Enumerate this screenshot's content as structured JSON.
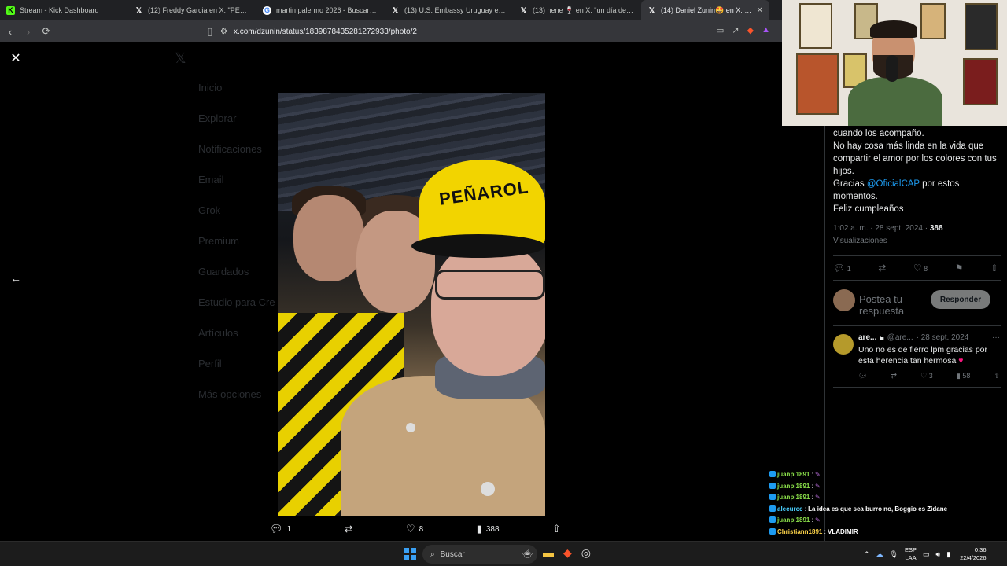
{
  "tabs": [
    {
      "title": "Stream - Kick Dashboard",
      "icon": "kick-icon"
    },
    {
      "title": "(12) Freddy Garcia en X: \"PEÑAROL I",
      "icon": "x-icon"
    },
    {
      "title": "martin palermo 2026 - Buscar con G",
      "icon": "google-icon"
    },
    {
      "title": "(13) U.S. Embassy Uruguay en X: \"El I",
      "icon": "x-icon"
    },
    {
      "title": "(13) nene 🍷 en X: \"un día de recupe",
      "icon": "x-icon"
    },
    {
      "title": "(14) Daniel Zunin🤩 en X: \"Hac",
      "icon": "x-icon"
    }
  ],
  "address": {
    "url": "x.com/dzunin/status/1839878435281272933/photo/2"
  },
  "sidebar_ghost": [
    "Inicio",
    "Explorar",
    "Notificaciones",
    "Email",
    "Grok",
    "Premium",
    "Guardados",
    "Estudio para Cre",
    "Artículos",
    "Perfil",
    "Más opciones"
  ],
  "photo_actions": {
    "replies": "1",
    "likes": "8",
    "views": "388"
  },
  "tweet": {
    "lines": [
      "cuando los acompaño.",
      "No hay cosa más linda en la vida que compartir el amor por los colores con tus hijos.",
      "Gracias "
    ],
    "mention": "@OficialCAP",
    "after_mention": " por estos momentos.",
    "closing": "Feliz cumpleaños",
    "time": "1:02 a. m. · 28 sept. 2024 · ",
    "views": "388",
    "views_label": "Visualizaciones",
    "replies": "1",
    "likes": "8"
  },
  "reply_box": {
    "placeholder": "Postea tu respuesta",
    "button": "Responder"
  },
  "comment": {
    "name": "are...",
    "handle": "@are...",
    "date": "· 28 sept. 2024",
    "text": "Uno no es de fierro lpm gracias por esta herencia tan hermosa",
    "likes": "3",
    "views": "58"
  },
  "hat_text": "PEÑAROL",
  "chat": [
    {
      "user": "juanpi1891",
      "msg": "",
      "emote": true,
      "color": "#8be04a"
    },
    {
      "user": "juanpi1891",
      "msg": "",
      "emote": true,
      "color": "#8be04a"
    },
    {
      "user": "juanpi1891",
      "msg": "",
      "emote": true,
      "color": "#8be04a"
    },
    {
      "user": "alecurcc",
      "msg": "La idea es que sea burro no, Boggio es Zidane",
      "emote": false,
      "color": "#4ad0ff"
    },
    {
      "user": "juanpi1891",
      "msg": "",
      "emote": true,
      "color": "#8be04a"
    },
    {
      "user": "Christiann1891",
      "msg": "VLADIMIR",
      "emote": false,
      "color": "#ffd54a"
    }
  ],
  "taskbar": {
    "search": "Buscar",
    "lang_top": "ESP",
    "lang_bottom": "LAA",
    "time": "0:36",
    "date": "22/4/2026"
  }
}
